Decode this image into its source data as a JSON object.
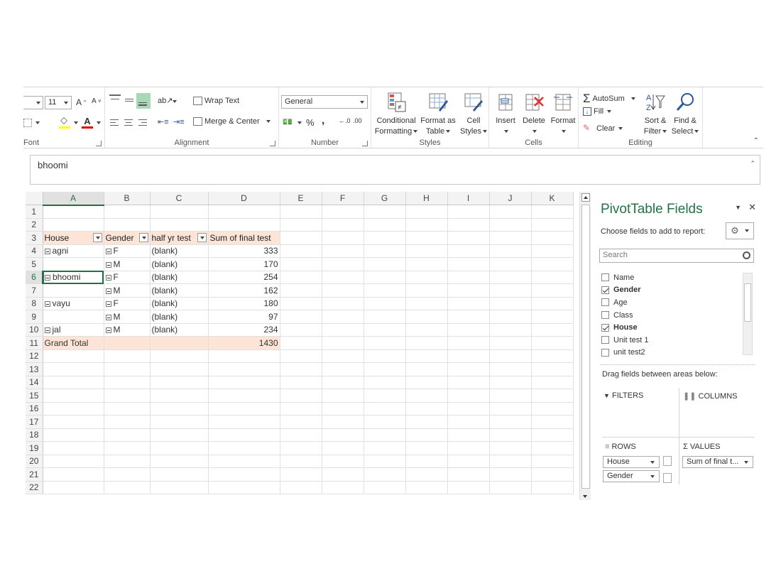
{
  "ribbon": {
    "font": {
      "label": "Font",
      "size": "11"
    },
    "alignment": {
      "label": "Alignment",
      "wrap_text": "Wrap Text",
      "merge_center": "Merge & Center"
    },
    "number": {
      "label": "Number",
      "format": "General",
      "percent": "%",
      "comma": ","
    },
    "styles": {
      "label": "Styles",
      "conditional": "Conditional",
      "conditional2": "Formatting",
      "format_as": "Format as",
      "format_as2": "Table",
      "cell": "Cell",
      "cell2": "Styles"
    },
    "cells": {
      "label": "Cells",
      "insert": "Insert",
      "delete": "Delete",
      "format": "Format"
    },
    "editing": {
      "label": "Editing",
      "autosum": "AutoSum",
      "fill": "Fill",
      "clear": "Clear",
      "sort": "Sort &",
      "sort2": "Filter",
      "find": "Find &",
      "find2": "Select"
    }
  },
  "formula_bar": {
    "value": "bhoomi"
  },
  "grid": {
    "columns": [
      "A",
      "B",
      "C",
      "D",
      "E",
      "F",
      "G",
      "H",
      "I",
      "J",
      "K"
    ],
    "pivot_headers": {
      "house": "House",
      "gender": "Gender",
      "half": "half yr test",
      "sum": "Sum of final test"
    },
    "rows": [
      {
        "num": "4",
        "house": "agni",
        "gender": "F",
        "half": "(blank)",
        "sum": "333"
      },
      {
        "num": "5",
        "house": "",
        "gender": "M",
        "half": "(blank)",
        "sum": "170"
      },
      {
        "num": "6",
        "house": "bhoomi",
        "gender": "F",
        "half": "(blank)",
        "sum": "254"
      },
      {
        "num": "7",
        "house": "",
        "gender": "M",
        "half": "(blank)",
        "sum": "162"
      },
      {
        "num": "8",
        "house": "vayu",
        "gender": "F",
        "half": "(blank)",
        "sum": "180"
      },
      {
        "num": "9",
        "house": "",
        "gender": "M",
        "half": "(blank)",
        "sum": "97"
      },
      {
        "num": "10",
        "house": "jal",
        "gender": "M",
        "half": "(blank)",
        "sum": "234"
      }
    ],
    "grand_total_label": "Grand Total",
    "grand_total_value": "1430",
    "row_numbers": [
      "1",
      "2",
      "3",
      "4",
      "5",
      "6",
      "7",
      "8",
      "9",
      "10",
      "11",
      "12",
      "13",
      "14",
      "15",
      "16",
      "17",
      "18",
      "19",
      "20",
      "21",
      "22"
    ]
  },
  "pivot_pane": {
    "title": "PivotTable Fields",
    "subtitle": "Choose fields to add to report:",
    "search_placeholder": "Search",
    "fields": [
      {
        "name": "Name",
        "checked": false
      },
      {
        "name": "Gender",
        "checked": true
      },
      {
        "name": "Age",
        "checked": false
      },
      {
        "name": "Class",
        "checked": false
      },
      {
        "name": "House",
        "checked": true
      },
      {
        "name": "Unit test 1",
        "checked": false
      },
      {
        "name": "unit test2",
        "checked": false
      }
    ],
    "drag_label": "Drag fields between areas below:",
    "filters_label": "FILTERS",
    "columns_label": "COLUMNS",
    "rows_label": "ROWS",
    "values_label": "VALUES",
    "rows_items": [
      "House",
      "Gender"
    ],
    "values_items": [
      "Sum of final t..."
    ]
  },
  "colors": {
    "accent": "#217346",
    "pivot_header_fill": "#fce4d6"
  }
}
